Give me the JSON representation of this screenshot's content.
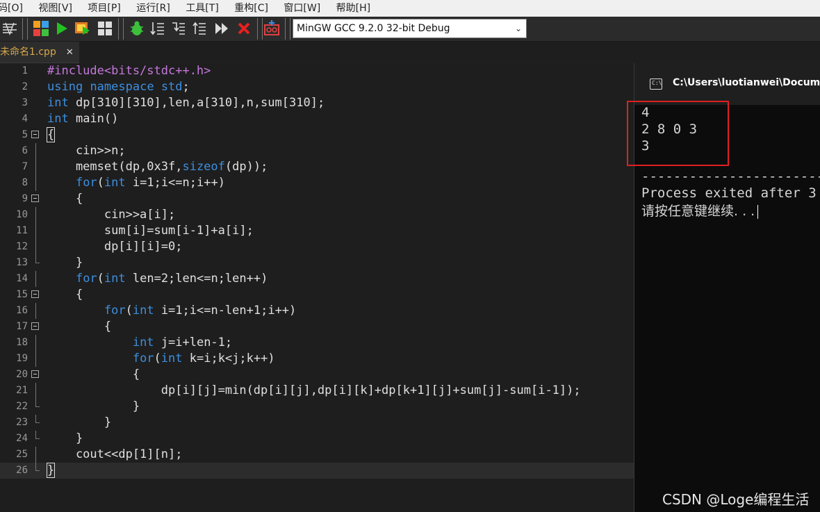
{
  "menu": [
    "码[O]",
    "视图[V]",
    "项目[P]",
    "运行[R]",
    "工具[T]",
    "重构[C]",
    "窗口[W]",
    "帮助[H]"
  ],
  "toolbar": {
    "compiler": "MinGW GCC 9.2.0 32-bit Debug"
  },
  "tab": {
    "filename": "未命名1.cpp",
    "close": "✕"
  },
  "code": {
    "lines": [
      {
        "n": "1"
      },
      {
        "n": "2"
      },
      {
        "n": "3"
      },
      {
        "n": "4"
      },
      {
        "n": "5"
      },
      {
        "n": "6"
      },
      {
        "n": "7"
      },
      {
        "n": "8"
      },
      {
        "n": "9"
      },
      {
        "n": "10"
      },
      {
        "n": "11"
      },
      {
        "n": "12"
      },
      {
        "n": "13"
      },
      {
        "n": "14"
      },
      {
        "n": "15"
      },
      {
        "n": "16"
      },
      {
        "n": "17"
      },
      {
        "n": "18"
      },
      {
        "n": "19"
      },
      {
        "n": "20"
      },
      {
        "n": "21"
      },
      {
        "n": "22"
      },
      {
        "n": "23"
      },
      {
        "n": "24"
      },
      {
        "n": "25"
      },
      {
        "n": "26"
      }
    ],
    "text": {
      "l1a": "#include<bits/stdc++.h>",
      "l2a": "using",
      "l2b": " ",
      "l2c": "namespace",
      "l2d": " ",
      "l2e": "std",
      "l2f": ";",
      "l3a": "int",
      "l3b": " dp[310][310],len,a[310],n,sum[310];",
      "l4a": "int",
      "l4b": " main()",
      "l5a": "{",
      "l6a": "    cin>>n;",
      "l7a": "    memset(dp,0x3f,",
      "l7b": "sizeof",
      "l7c": "(dp));",
      "l8a": "    ",
      "l8b": "for",
      "l8c": "(",
      "l8d": "int",
      "l8e": " i=1;i<=n;i++)",
      "l9a": "    {",
      "l10a": "        cin>>a[i];",
      "l11a": "        sum[i]=sum[i-1]+a[i];",
      "l12a": "        dp[i][i]=0;",
      "l13a": "    }",
      "l14a": "    ",
      "l14b": "for",
      "l14c": "(",
      "l14d": "int",
      "l14e": " len=2;len<=n;len++)",
      "l15a": "    {",
      "l16a": "        ",
      "l16b": "for",
      "l16c": "(",
      "l16d": "int",
      "l16e": " i=1;i<=n-len+1;i++)",
      "l17a": "        {",
      "l18a": "            ",
      "l18b": "int",
      "l18c": " j=i+len-1;",
      "l19a": "            ",
      "l19b": "for",
      "l19c": "(",
      "l19d": "int",
      "l19e": " k=i;k<j;k++)",
      "l20a": "            {",
      "l21a": "                dp[i][j]=min(dp[i][j],dp[i][k]+dp[k+1][j]+sum[j]-sum[i-1]);",
      "l22a": "            }",
      "l23a": "        }",
      "l24a": "    }",
      "l25a": "    cout<<dp[1][n];",
      "l26a": "}"
    }
  },
  "console": {
    "title": "C:\\Users\\luotianwei\\Documer",
    "icon_text": "C:\\",
    "input_line1": "4",
    "input_line2": "2 8 0 3",
    "output_line": "3",
    "divider": "--------------------------------",
    "exit_line": "Process exited after 3",
    "prompt_line": "请按任意键继续. . ."
  },
  "watermark": "CSDN @Loge编程生活",
  "colors": {
    "keyword": "#3d8fe0",
    "preprocessor": "#c678dd",
    "highlight_box": "#e02020",
    "tab_text": "#d7a94b"
  }
}
